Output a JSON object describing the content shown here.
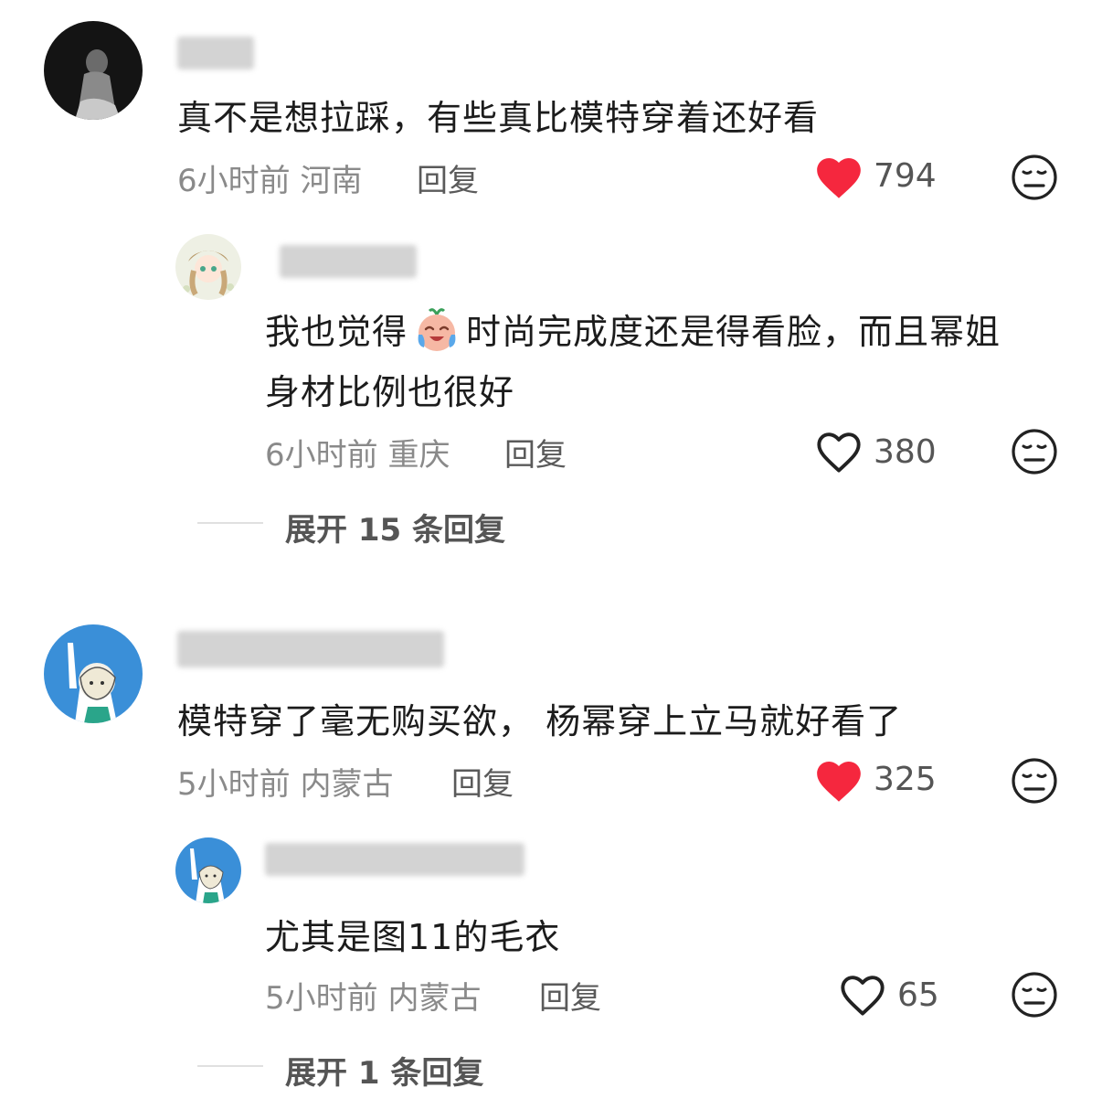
{
  "comments": [
    {
      "text": "真不是想拉踩，有些真比模特穿着还好看",
      "time_location": "6小时前 河南",
      "reply_label": "回复",
      "likes": "794",
      "liked": true,
      "replies": [
        {
          "text_before": "我也觉得",
          "text_after": "时尚完成度还是得看脸，而且幂姐",
          "text_line2": "身材比例也很好",
          "time_location": "6小时前 重庆",
          "reply_label": "回复",
          "likes": "380",
          "liked": false
        }
      ],
      "expand_label": "展开 15 条回复"
    },
    {
      "text": "模特穿了毫无购买欲， 杨幂穿上立马就好看了",
      "time_location": "5小时前 内蒙古",
      "reply_label": "回复",
      "likes": "325",
      "liked": true,
      "replies": [
        {
          "text": "尤其是图11的毛衣",
          "time_location": "5小时前 内蒙古",
          "reply_label": "回复",
          "likes": "65",
          "liked": false
        }
      ],
      "expand_label": "展开 1 条回复"
    }
  ],
  "colors": {
    "liked_heart": "#f5273e",
    "meta_gray": "#8a8a8a",
    "text": "#1c1c1c"
  },
  "icons": [
    "heart-filled-icon",
    "heart-outline-icon",
    "meh-face-icon",
    "crying-laughing-emoji"
  ]
}
